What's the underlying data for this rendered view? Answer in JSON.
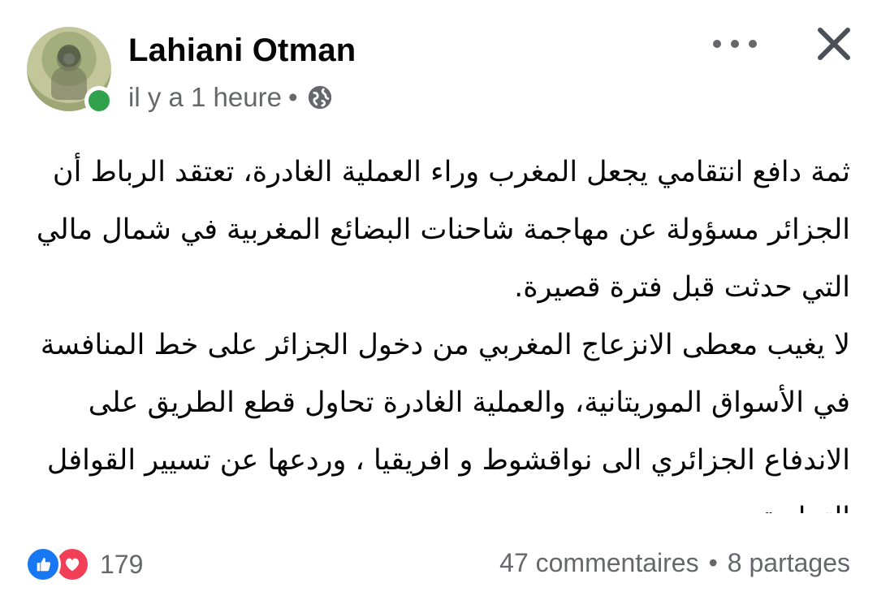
{
  "post": {
    "author": "Lahiani Otman",
    "timestamp": "il y a 1 heure",
    "separator": "•",
    "privacy_icon": "globe-icon",
    "paragraphs": [
      "ثمة دافع انتقامي يجعل المغرب وراء العملية الغادرة، تعتقد الرباط أن الجزائر مسؤولة عن مهاجمة شاحنات البضائع المغربية في شمال مالي التي حدثت قبل فترة قصيرة.",
      "لا يغيب معطى الانزعاج المغربي من دخول الجزائر على خط المنافسة في الأسواق الموريتانية، والعملية الغادرة تحاول قطع الطريق على الاندفاع الجزائري الى نواقشوط و افريقيا ، وردعها عن تسيير القوافل التجارية ."
    ]
  },
  "header": {
    "more_icon": "more-options-icon",
    "close_icon": "close-icon"
  },
  "footer": {
    "reaction_count": "179",
    "comments": "47 commentaires",
    "dot": "•",
    "shares": "8 partages"
  },
  "colors": {
    "online": "#31a24c",
    "like": "#1877f2",
    "love": "#f33e58",
    "secondary_text": "#65676b"
  }
}
